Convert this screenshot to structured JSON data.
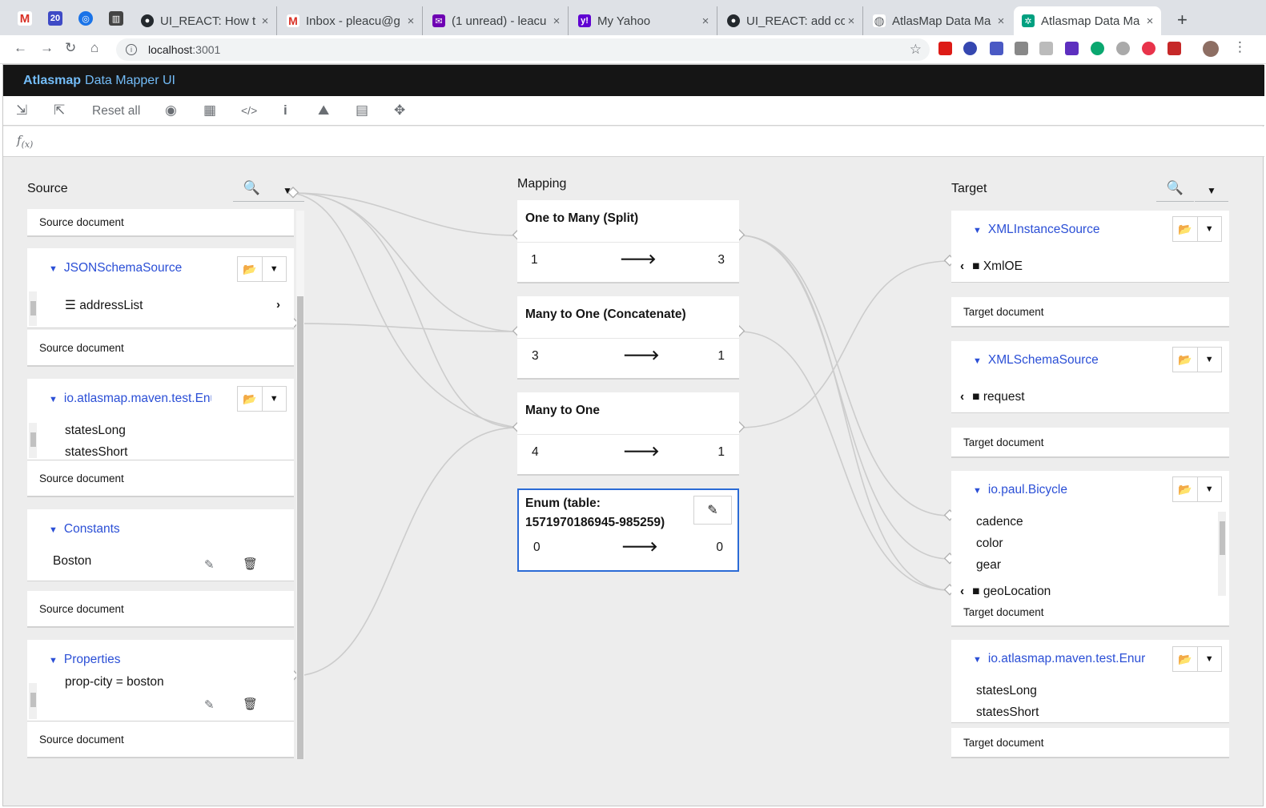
{
  "browser": {
    "pinned_tabs": [
      {
        "icon": "gmail-icon",
        "color": "#d93025",
        "glyph": "M"
      },
      {
        "icon": "calendar-icon",
        "color": "#3e4ac6",
        "glyph": "20"
      },
      {
        "icon": "target-icon",
        "color": "#1a73e8",
        "glyph": "◎"
      },
      {
        "icon": "app-icon",
        "color": "#444444",
        "glyph": "▥"
      }
    ],
    "tabs": [
      {
        "title": "UI_REACT: How t",
        "icon": "github-icon",
        "color": "#24292e",
        "glyph": "●"
      },
      {
        "title": "Inbox - pleacu@g",
        "icon": "gmail-icon",
        "color": "#d93025",
        "glyph": "M"
      },
      {
        "title": "(1 unread) - leacu",
        "icon": "mail-icon",
        "color": "#6e00b3",
        "glyph": "✉"
      },
      {
        "title": "My Yahoo",
        "icon": "yahoo-icon",
        "color": "#6001d2",
        "glyph": "y!"
      },
      {
        "title": "UI_REACT: add co",
        "icon": "github-icon",
        "color": "#24292e",
        "glyph": "●"
      },
      {
        "title": "AtlasMap Data Ma",
        "icon": "globe-icon",
        "color": "#5f6368",
        "glyph": "◍"
      },
      {
        "title": "Atlasmap Data Ma",
        "icon": "atlasmap-icon",
        "color": "#00a080",
        "glyph": "✲",
        "active": true
      }
    ],
    "close_glyph": "×",
    "new_tab_glyph": "+",
    "url_host": "localhost",
    "url_port": ":3001"
  },
  "app": {
    "brand_bold": "Atlasmap",
    "brand_rest": "Data Mapper UI",
    "toolbar": {
      "reset_label": "Reset all",
      "buttons": [
        "import-icon",
        "export-icon",
        "eye-icon",
        "table-icon",
        "code-icon",
        "info-icon",
        "map-marked-icon",
        "map-icon",
        "arrows-icon"
      ]
    },
    "fx_label": "f",
    "fx_sub": "(x)"
  },
  "source": {
    "header": "Source",
    "doc_footer": "Source document",
    "docs": [
      {
        "name": "JSONSchemaSource",
        "fields": [
          "addressList"
        ]
      },
      {
        "name": "io.atlasmap.maven.test.Enu",
        "fields": [
          "statesLong",
          "statesShort"
        ]
      },
      {
        "name": "Constants",
        "fields": [
          "Boston"
        ]
      },
      {
        "name": "Properties",
        "fields": [
          "prop-city = boston"
        ]
      }
    ]
  },
  "mapping": {
    "header": "Mapping",
    "cards": [
      {
        "title": "One to Many (Split)",
        "left": "1",
        "right": "3"
      },
      {
        "title": "Many to One (Concatenate)",
        "left": "3",
        "right": "1"
      },
      {
        "title": "Many to One",
        "left": "4",
        "right": "1"
      },
      {
        "title_line1": "Enum (table:",
        "title_line2": "1571970186945-985259)",
        "left": "0",
        "right": "0",
        "selected": true
      }
    ],
    "arrow": "🡒"
  },
  "target": {
    "header": "Target",
    "doc_footer": "Target document",
    "docs": [
      {
        "name": "XMLInstanceSource",
        "fields": [
          "XmlOE"
        ]
      },
      {
        "name": "XMLSchemaSource",
        "fields": [
          "request"
        ]
      },
      {
        "name": "io.paul.Bicycle",
        "fields": [
          "cadence",
          "color",
          "gear",
          "geoLocation"
        ]
      },
      {
        "name": "io.atlasmap.maven.test.Enur",
        "fields": [
          "statesLong",
          "statesShort"
        ]
      }
    ]
  },
  "colors": {
    "brand_bar": "#151515",
    "brand_text": "#73bcf7",
    "doc_link": "#2b4fd6",
    "selected_border": "#2b6bd6",
    "line": "#cccccc"
  }
}
